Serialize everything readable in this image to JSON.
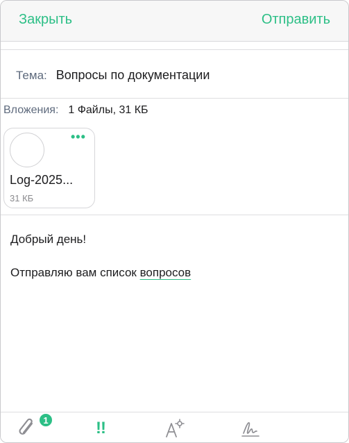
{
  "header": {
    "close_label": "Закрыть",
    "send_label": "Отправить"
  },
  "subject": {
    "label": "Тема:",
    "value": "Вопросы по документации"
  },
  "attachments": {
    "label": "Вложения:",
    "summary": "1 Файлы, 31 КБ",
    "files": [
      {
        "name": "Log-2025...",
        "size": "31 КБ"
      }
    ]
  },
  "body": {
    "greeting": "Добрый день!",
    "line_prefix": "Отправляю вам список ",
    "line_underlined": "вопросов"
  },
  "toolbar": {
    "attach_badge": "1",
    "priority_glyph": "!!"
  },
  "colors": {
    "accent": "#2cbf86",
    "label": "#5e6a7d"
  }
}
